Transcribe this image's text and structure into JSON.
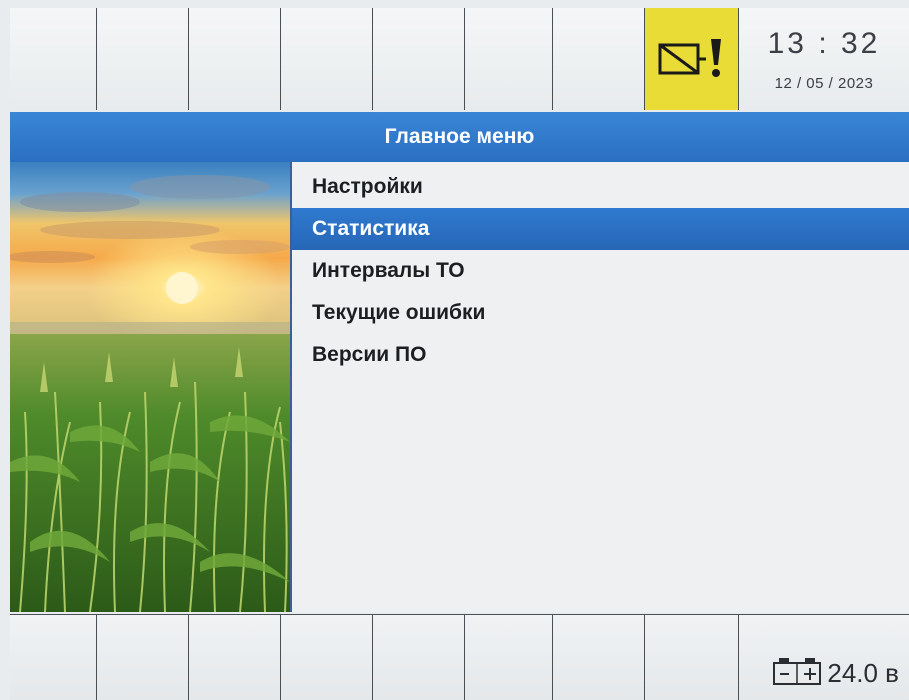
{
  "header": {
    "time": "13 : 32",
    "date": "12 / 05 / 2023",
    "warning_icon": "sensor-warning-icon",
    "warning_color": "#e9dc37"
  },
  "title_bar": {
    "title": "Главное меню",
    "color": "#2b6fc2"
  },
  "menu": {
    "items": [
      {
        "label": "Настройки",
        "selected": false
      },
      {
        "label": "Статистика",
        "selected": true
      },
      {
        "label": "Интервалы ТО",
        "selected": false
      },
      {
        "label": "Текущие ошибки",
        "selected": false
      },
      {
        "label": "Версии ПО",
        "selected": false
      }
    ],
    "selection_color": "#2766b6"
  },
  "side_image": {
    "icon": "cornfield-sunset-image"
  },
  "footer": {
    "battery_icon": "battery-icon",
    "battery_voltage": "24.0 в"
  }
}
